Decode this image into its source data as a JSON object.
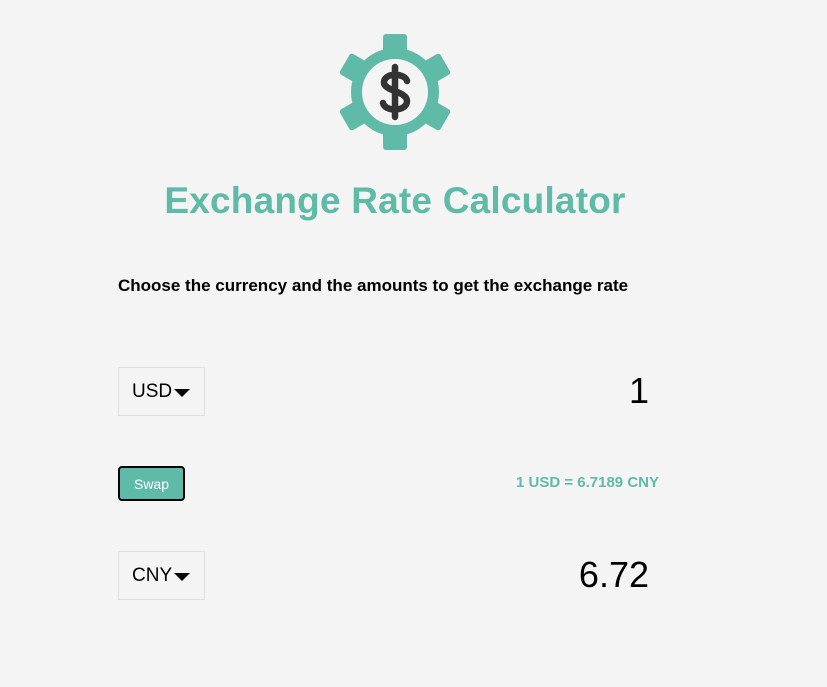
{
  "logo": {
    "icon": "gear-dollar-icon",
    "color": "#5fbaa7"
  },
  "title": "Exchange Rate Calculator",
  "subtitle": "Choose the currency and the amounts to get the exchange rate",
  "currency_one": {
    "selected": "USD",
    "amount": "1"
  },
  "swap_label": "Swap",
  "rate_text": "1 USD = 6.7189 CNY",
  "currency_two": {
    "selected": "CNY",
    "amount": "6.72"
  },
  "colors": {
    "accent": "#5fbaa7",
    "background": "#f4f4f4"
  }
}
